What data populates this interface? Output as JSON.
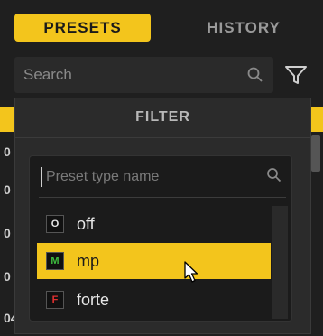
{
  "tabs": [
    {
      "label": "PRESETS",
      "active": true
    },
    {
      "label": "HISTORY",
      "active": false
    }
  ],
  "search": {
    "placeholder": "Search"
  },
  "background_rows": [
    "0",
    "0",
    "0",
    "0",
    "04"
  ],
  "filter_panel": {
    "title": "FILTER",
    "type_input": {
      "placeholder": "Preset type name"
    },
    "options": [
      {
        "badge": "O",
        "label": "off",
        "badge_color": "#e6e6e6",
        "selected": false
      },
      {
        "badge": "M",
        "label": "mp",
        "badge_color": "#3fbf3f",
        "selected": true
      },
      {
        "badge": "F",
        "label": "forte",
        "badge_color": "#e03030",
        "selected": false
      }
    ]
  },
  "colors": {
    "accent": "#f3c51c",
    "background": "#1f1f1f",
    "panel": "#2b2b2b"
  }
}
